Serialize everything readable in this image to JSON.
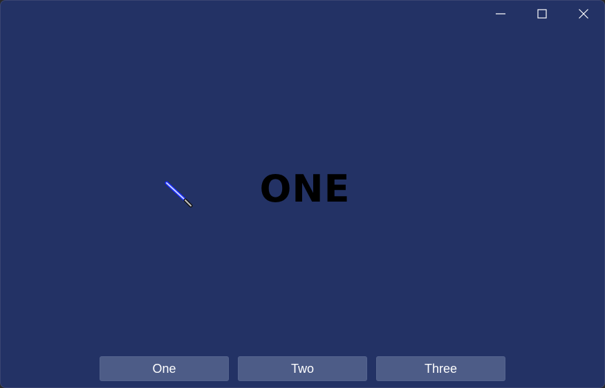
{
  "window": {
    "controls": {
      "minimize_icon": "minimize-icon",
      "maximize_icon": "maximize-icon",
      "close_icon": "close-icon"
    },
    "background_color": "#233265"
  },
  "main": {
    "headline": "ONE",
    "cursor_icon": "lightsaber-cursor-icon"
  },
  "buttons": [
    {
      "label": "One"
    },
    {
      "label": "Two"
    },
    {
      "label": "Three"
    }
  ],
  "colors": {
    "button_bg": "#4d5c87",
    "button_text": "#ffffff",
    "headline_text": "#000000"
  }
}
